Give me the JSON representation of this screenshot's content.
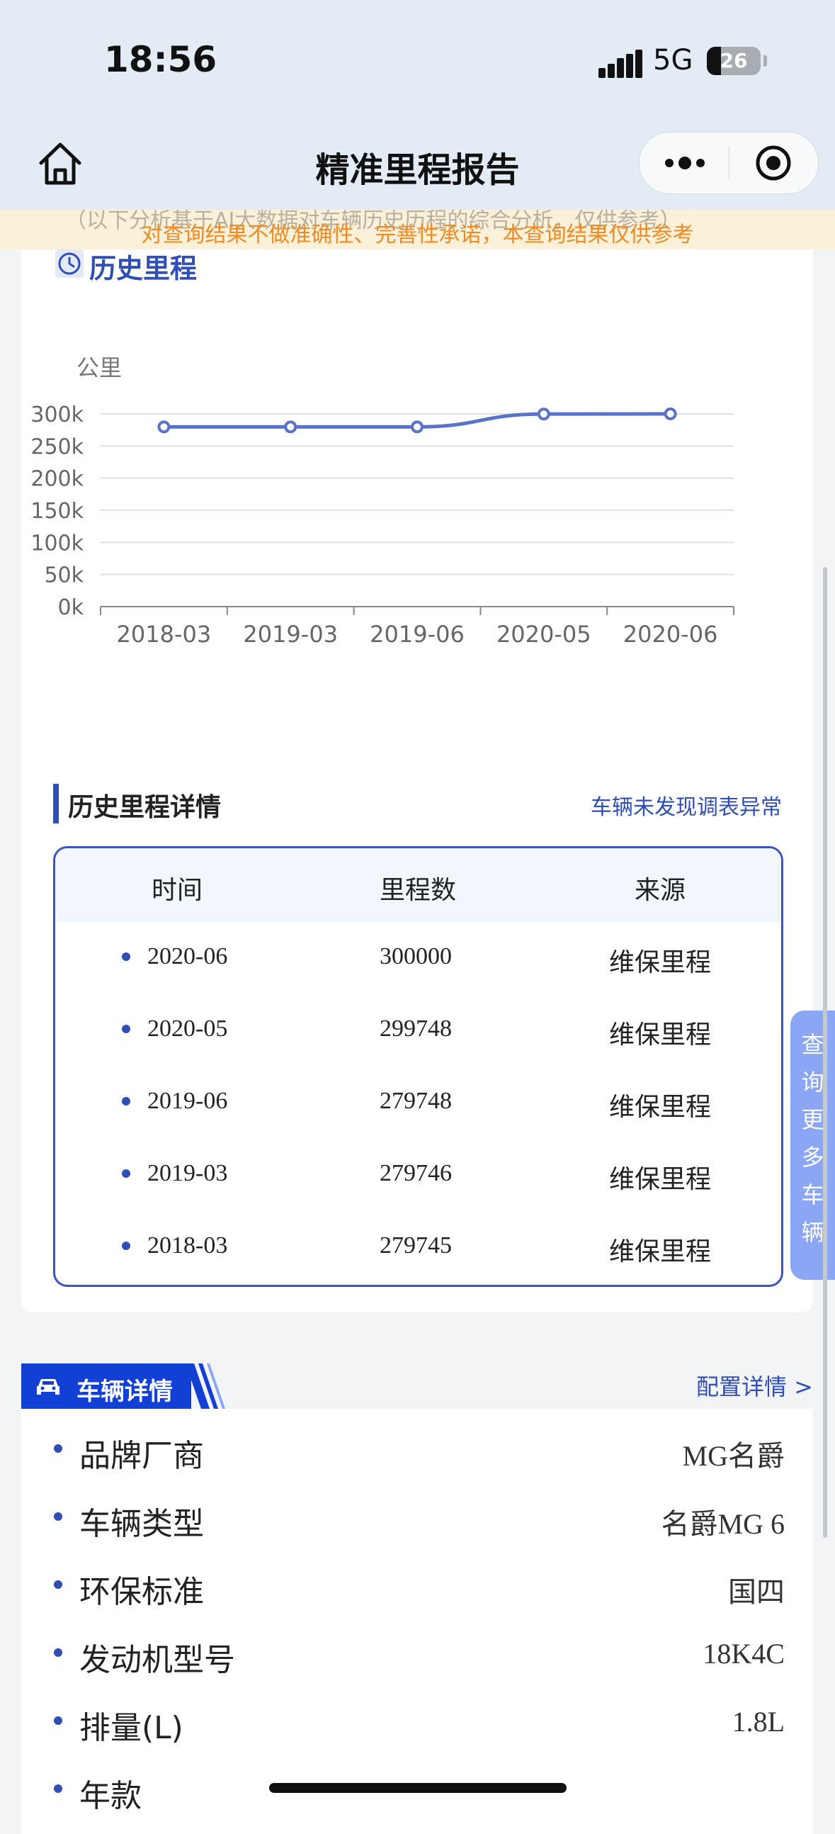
{
  "status": {
    "time": "18:56",
    "network": "5G",
    "battery": "26"
  },
  "nav": {
    "title": "精准里程报告"
  },
  "notice": {
    "ghost_text": "（以下分析基于AI大数据对车辆历史历程的综合分析，仅供参考）",
    "text": "对查询结果不做准确性、完善性承诺，本查询结果仅供参考"
  },
  "history": {
    "title": "历史里程",
    "y_unit": "公里",
    "x_labels": [
      "2018-03",
      "2019-03",
      "2019-06",
      "2020-05",
      "2020-06"
    ],
    "y_ticks": [
      "300k",
      "250k",
      "200k",
      "150k",
      "100k",
      "50k",
      "0k"
    ]
  },
  "chart_data": {
    "type": "line",
    "categories": [
      "2018-03",
      "2019-03",
      "2019-06",
      "2020-05",
      "2020-06"
    ],
    "values": [
      279745,
      279746,
      279748,
      299748,
      300000
    ],
    "ylabel": "公里",
    "ylim": [
      0,
      300000
    ],
    "yticks": [
      0,
      50000,
      100000,
      150000,
      200000,
      250000,
      300000
    ],
    "color": "#5a73c8",
    "grid": true
  },
  "details": {
    "title": "历史里程详情",
    "link": "车辆未发现调表异常",
    "headers": {
      "time": "时间",
      "mileage": "里程数",
      "source": "来源"
    },
    "rows": [
      {
        "date": "2020-06",
        "mileage": "300000",
        "source": "维保里程"
      },
      {
        "date": "2020-05",
        "mileage": "299748",
        "source": "维保里程"
      },
      {
        "date": "2019-06",
        "mileage": "279748",
        "source": "维保里程"
      },
      {
        "date": "2019-03",
        "mileage": "279746",
        "source": "维保里程"
      },
      {
        "date": "2018-03",
        "mileage": "279745",
        "source": "维保里程"
      }
    ]
  },
  "float_tab": {
    "chars": [
      "查",
      "询",
      "更",
      "多",
      "车",
      "辆"
    ]
  },
  "vehicle": {
    "tab_label": "车辆详情",
    "config_link": "配置详情 >",
    "items": [
      {
        "key": "品牌厂商",
        "value": "MG名爵"
      },
      {
        "key": "车辆类型",
        "value": "名爵MG 6"
      },
      {
        "key": "环保标准",
        "value": "国四"
      },
      {
        "key": "发动机型号",
        "value": "18K4C"
      },
      {
        "key": "排量(L)",
        "value": "1.8L"
      },
      {
        "key": "年款",
        "value": ""
      }
    ]
  }
}
